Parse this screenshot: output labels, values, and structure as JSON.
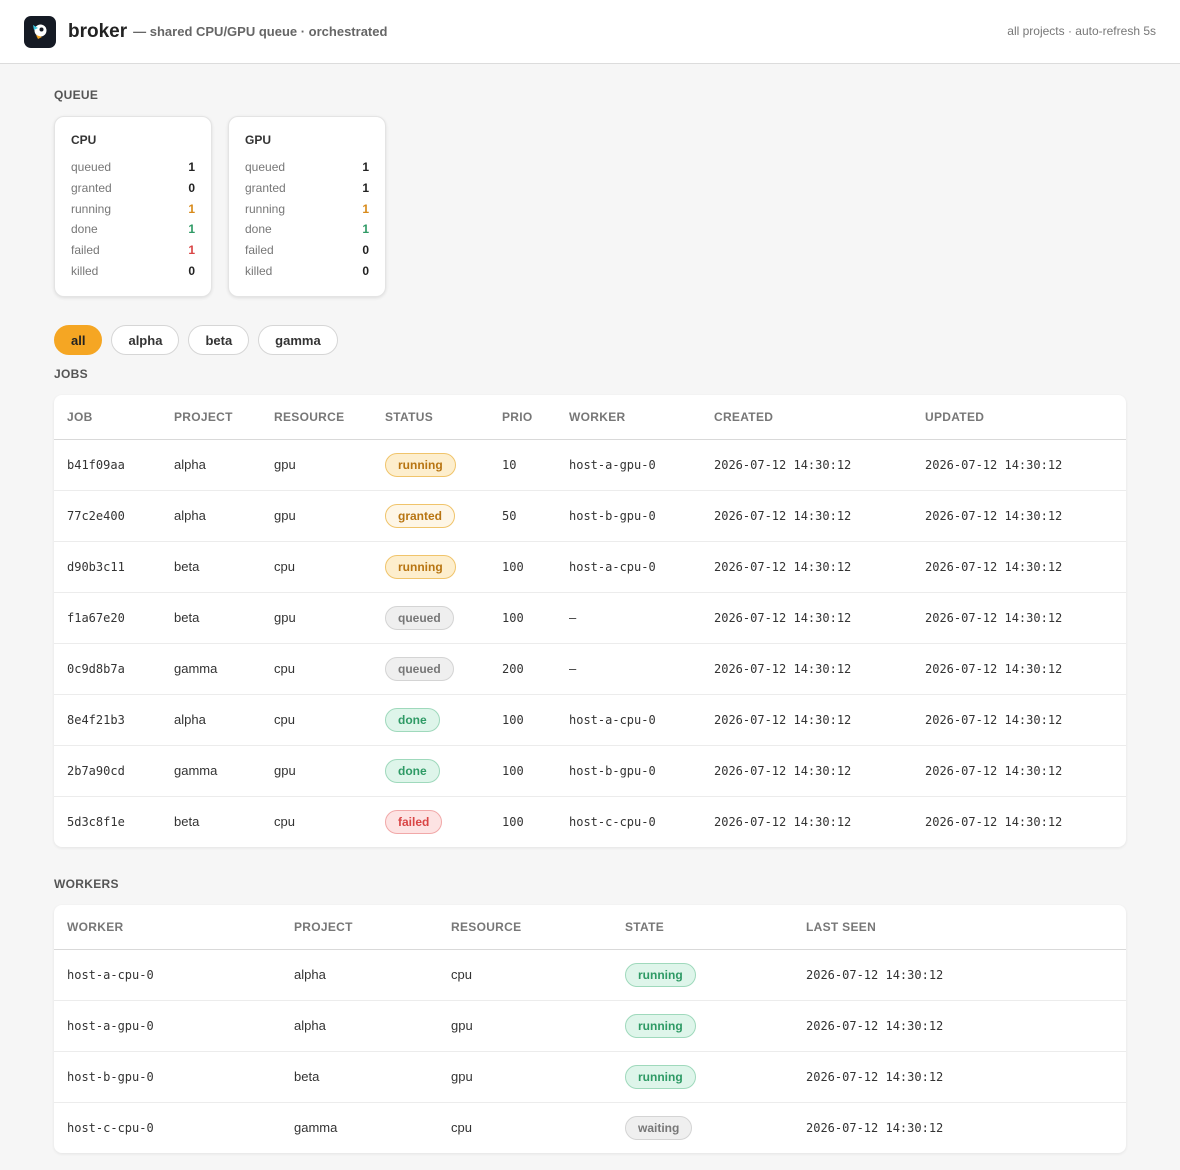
{
  "header": {
    "brand": "broker",
    "tagline": "— shared CPU/GPU queue · orchestrated",
    "right_text": "all projects · auto-refresh 5s"
  },
  "queue": {
    "title": "QUEUE",
    "cards": [
      {
        "title": "CPU",
        "stats": [
          {
            "label": "queued",
            "value": "1",
            "color": "#222222"
          },
          {
            "label": "granted",
            "value": "0",
            "color": "#222222"
          },
          {
            "label": "running",
            "value": "1",
            "color": "#d88a1a"
          },
          {
            "label": "done",
            "value": "1",
            "color": "#2e9a65"
          },
          {
            "label": "failed",
            "value": "1",
            "color": "#d94545"
          },
          {
            "label": "killed",
            "value": "0",
            "color": "#222222"
          }
        ]
      },
      {
        "title": "GPU",
        "stats": [
          {
            "label": "queued",
            "value": "1",
            "color": "#222222"
          },
          {
            "label": "granted",
            "value": "1",
            "color": "#222222"
          },
          {
            "label": "running",
            "value": "1",
            "color": "#d88a1a"
          },
          {
            "label": "done",
            "value": "1",
            "color": "#2e9a65"
          },
          {
            "label": "failed",
            "value": "0",
            "color": "#222222"
          },
          {
            "label": "killed",
            "value": "0",
            "color": "#222222"
          }
        ]
      }
    ]
  },
  "filters": {
    "items": [
      "all",
      "alpha",
      "beta",
      "gamma"
    ],
    "active": "all"
  },
  "jobs": {
    "title": "JOBS",
    "columns": [
      "JOB",
      "PROJECT",
      "RESOURCE",
      "STATUS",
      "PRIO",
      "WORKER",
      "CREATED",
      "UPDATED"
    ],
    "rows": [
      {
        "job": "b41f09aa",
        "project": "alpha",
        "resource": "gpu",
        "status": "running",
        "prio": "10",
        "worker": "host-a-gpu-0",
        "created": "2026-07-12 14:30:12",
        "updated": "2026-07-12 14:30:12"
      },
      {
        "job": "77c2e400",
        "project": "alpha",
        "resource": "gpu",
        "status": "granted",
        "prio": "50",
        "worker": "host-b-gpu-0",
        "created": "2026-07-12 14:30:12",
        "updated": "2026-07-12 14:30:12"
      },
      {
        "job": "d90b3c11",
        "project": "beta",
        "resource": "cpu",
        "status": "running",
        "prio": "100",
        "worker": "host-a-cpu-0",
        "created": "2026-07-12 14:30:12",
        "updated": "2026-07-12 14:30:12"
      },
      {
        "job": "f1a67e20",
        "project": "beta",
        "resource": "gpu",
        "status": "queued",
        "prio": "100",
        "worker": "—",
        "created": "2026-07-12 14:30:12",
        "updated": "2026-07-12 14:30:12"
      },
      {
        "job": "0c9d8b7a",
        "project": "gamma",
        "resource": "cpu",
        "status": "queued",
        "prio": "200",
        "worker": "—",
        "created": "2026-07-12 14:30:12",
        "updated": "2026-07-12 14:30:12"
      },
      {
        "job": "8e4f21b3",
        "project": "alpha",
        "resource": "cpu",
        "status": "done",
        "prio": "100",
        "worker": "host-a-cpu-0",
        "created": "2026-07-12 14:30:12",
        "updated": "2026-07-12 14:30:12"
      },
      {
        "job": "2b7a90cd",
        "project": "gamma",
        "resource": "gpu",
        "status": "done",
        "prio": "100",
        "worker": "host-b-gpu-0",
        "created": "2026-07-12 14:30:12",
        "updated": "2026-07-12 14:30:12"
      },
      {
        "job": "5d3c8f1e",
        "project": "beta",
        "resource": "cpu",
        "status": "failed",
        "prio": "100",
        "worker": "host-c-cpu-0",
        "created": "2026-07-12 14:30:12",
        "updated": "2026-07-12 14:30:12"
      }
    ]
  },
  "workers": {
    "title": "WORKERS",
    "columns": [
      "WORKER",
      "PROJECT",
      "RESOURCE",
      "STATE",
      "LAST SEEN"
    ],
    "rows": [
      {
        "worker": "host-a-cpu-0",
        "project": "alpha",
        "resource": "cpu",
        "state": "running",
        "last_seen": "2026-07-12 14:30:12"
      },
      {
        "worker": "host-a-gpu-0",
        "project": "alpha",
        "resource": "gpu",
        "state": "running",
        "last_seen": "2026-07-12 14:30:12"
      },
      {
        "worker": "host-b-gpu-0",
        "project": "beta",
        "resource": "gpu",
        "state": "running",
        "last_seen": "2026-07-12 14:30:12"
      },
      {
        "worker": "host-c-cpu-0",
        "project": "gamma",
        "resource": "cpu",
        "state": "waiting",
        "last_seen": "2026-07-12 14:30:12"
      }
    ]
  }
}
